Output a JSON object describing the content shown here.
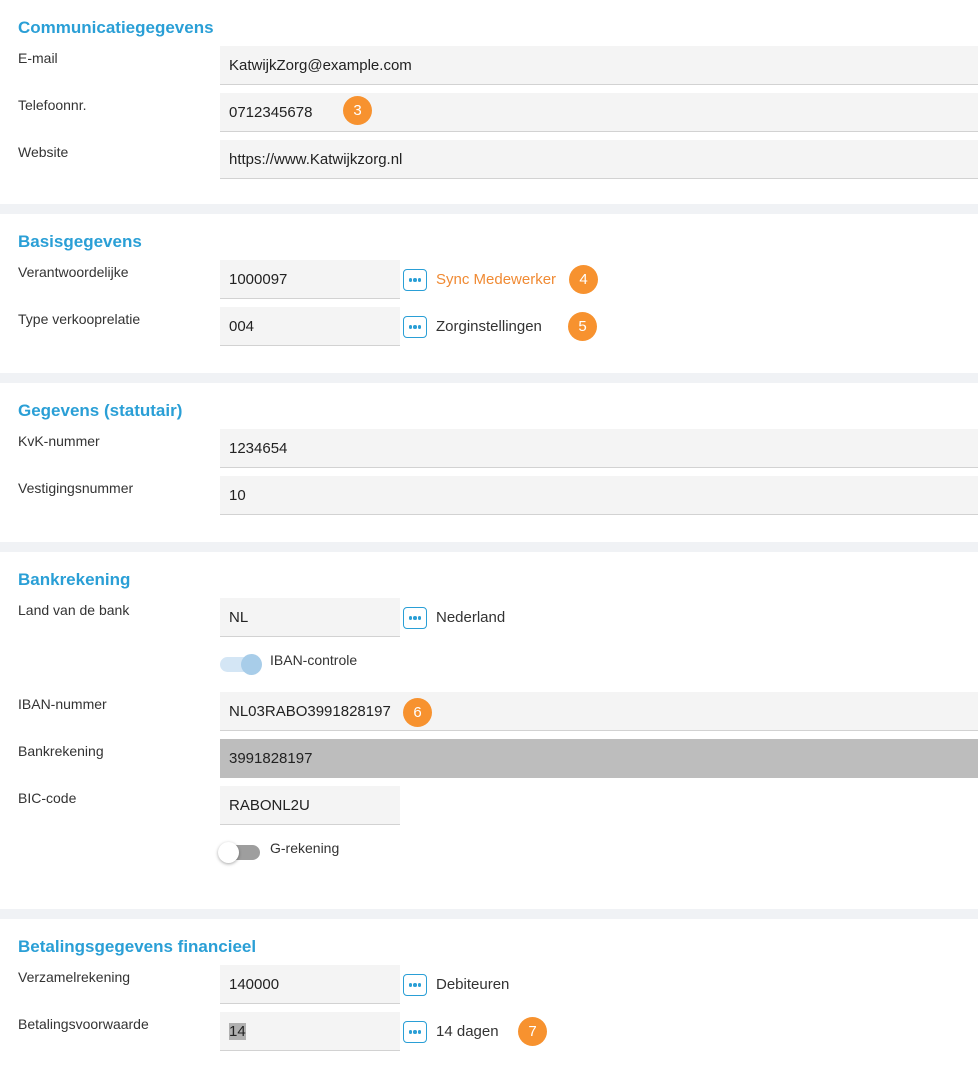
{
  "communicatie": {
    "title": "Communicatiegegevens",
    "email_label": "E-mail",
    "email_value": "KatwijkZorg@example.com",
    "telefoon_label": "Telefoonnr.",
    "telefoon_value": "0712345678",
    "telefoon_badge": "3",
    "website_label": "Website",
    "website_value": "https://www.Katwijkzorg.nl"
  },
  "basis": {
    "title": "Basisgegevens",
    "verantwoordelijke_label": "Verantwoordelijke",
    "verantwoordelijke_value": "1000097",
    "verantwoordelijke_desc": "Sync Medewerker",
    "verantwoordelijke_badge": "4",
    "type_label": "Type verkooprelatie",
    "type_value": "004",
    "type_desc": "Zorginstellingen",
    "type_badge": "5"
  },
  "statutair": {
    "title": "Gegevens (statutair)",
    "kvk_label": "KvK-nummer",
    "kvk_value": "1234654",
    "vestiging_label": "Vestigingsnummer",
    "vestiging_value": "10"
  },
  "bank": {
    "title": "Bankrekening",
    "land_label": "Land van de bank",
    "land_value": "NL",
    "land_desc": "Nederland",
    "iban_toggle_label": "IBAN-controle",
    "iban_toggle_on": true,
    "iban_label": "IBAN-nummer",
    "iban_value": "NL03RABO3991828197",
    "iban_badge": "6",
    "rekening_label": "Bankrekening",
    "rekening_value": "3991828197",
    "bic_label": "BIC-code",
    "bic_value": "RABONL2U",
    "g_toggle_label": "G-rekening",
    "g_toggle_on": false
  },
  "betaling": {
    "title": "Betalingsgegevens financieel",
    "verzamel_label": "Verzamelrekening",
    "verzamel_value": "140000",
    "verzamel_desc": "Debiteuren",
    "voorwaarde_label": "Betalingsvoorwaarde",
    "voorwaarde_value": "14",
    "voorwaarde_desc": "14 dagen",
    "voorwaarde_badge": "7"
  },
  "colors": {
    "accent": "#2a9fd6",
    "badge": "#f7922f",
    "link": "#f08a33"
  },
  "icons": {
    "lookup": "ellipsis-lookup-icon"
  }
}
